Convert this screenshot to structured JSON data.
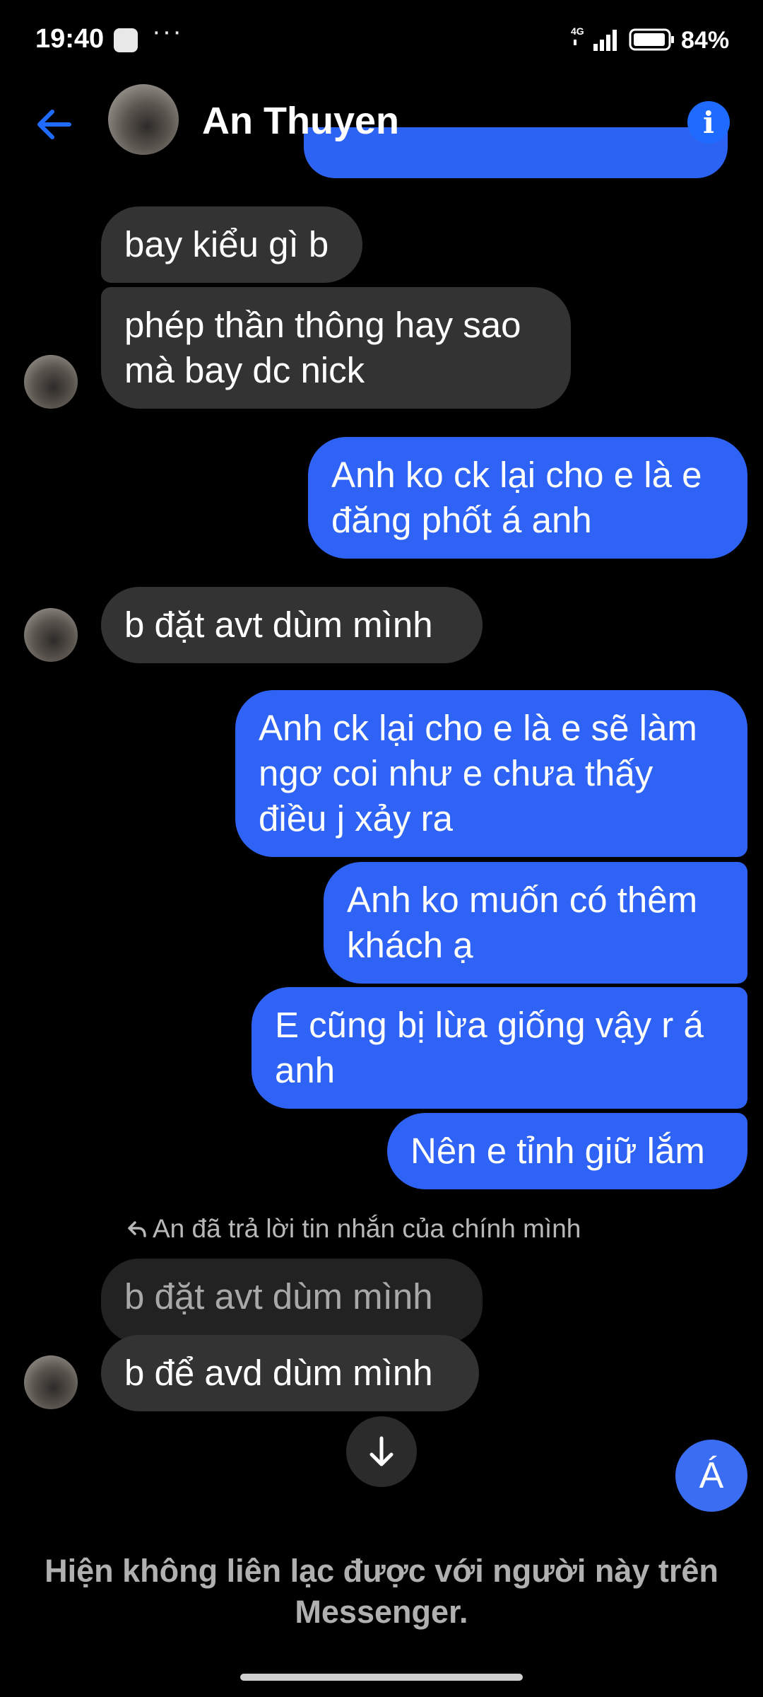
{
  "status_bar": {
    "time": "19:40",
    "dots": "···",
    "network": "4G",
    "battery_pct": "84%"
  },
  "header": {
    "contact_name": "An Thuyen"
  },
  "messages": [
    {
      "dir": "in",
      "text": "bay kiểu gì b"
    },
    {
      "dir": "in",
      "text": "phép thần thông hay sao\nmà bay dc nick"
    },
    {
      "dir": "out",
      "text": "Anh ko ck lại cho e là e\nđăng phốt á anh"
    },
    {
      "dir": "in",
      "text": "b đặt avt dùm mình"
    },
    {
      "dir": "out",
      "text": "Anh ck lại cho e là e sẽ làm\nngơ coi như e chưa thấy\nđiều j xảy ra"
    },
    {
      "dir": "out",
      "text": "Anh ko muốn có thêm\nkhách ạ"
    },
    {
      "dir": "out",
      "text": "E cũng bị lừa giống vậy r á\nanh"
    },
    {
      "dir": "out",
      "text": "Nên e tỉnh giữ lắm"
    },
    {
      "dir": "in",
      "text": "b đặt avt dùm mình"
    },
    {
      "dir": "in",
      "text": "b để avd dùm mình"
    }
  ],
  "reply_note": "An đã trả lời tin nhắn của chính mình",
  "quick_reaction_label": "Á",
  "footer_message": "Hiện không liên lạc được với người này trên Messenger.",
  "colors": {
    "outgoing_bubble": "#2f63f5",
    "incoming_bubble": "#333333",
    "accent": "#1f6bff"
  },
  "icons": [
    "back-arrow-icon",
    "info-icon",
    "reply-arrow-icon",
    "arrow-down-icon",
    "network-signal-icon",
    "battery-icon"
  ]
}
